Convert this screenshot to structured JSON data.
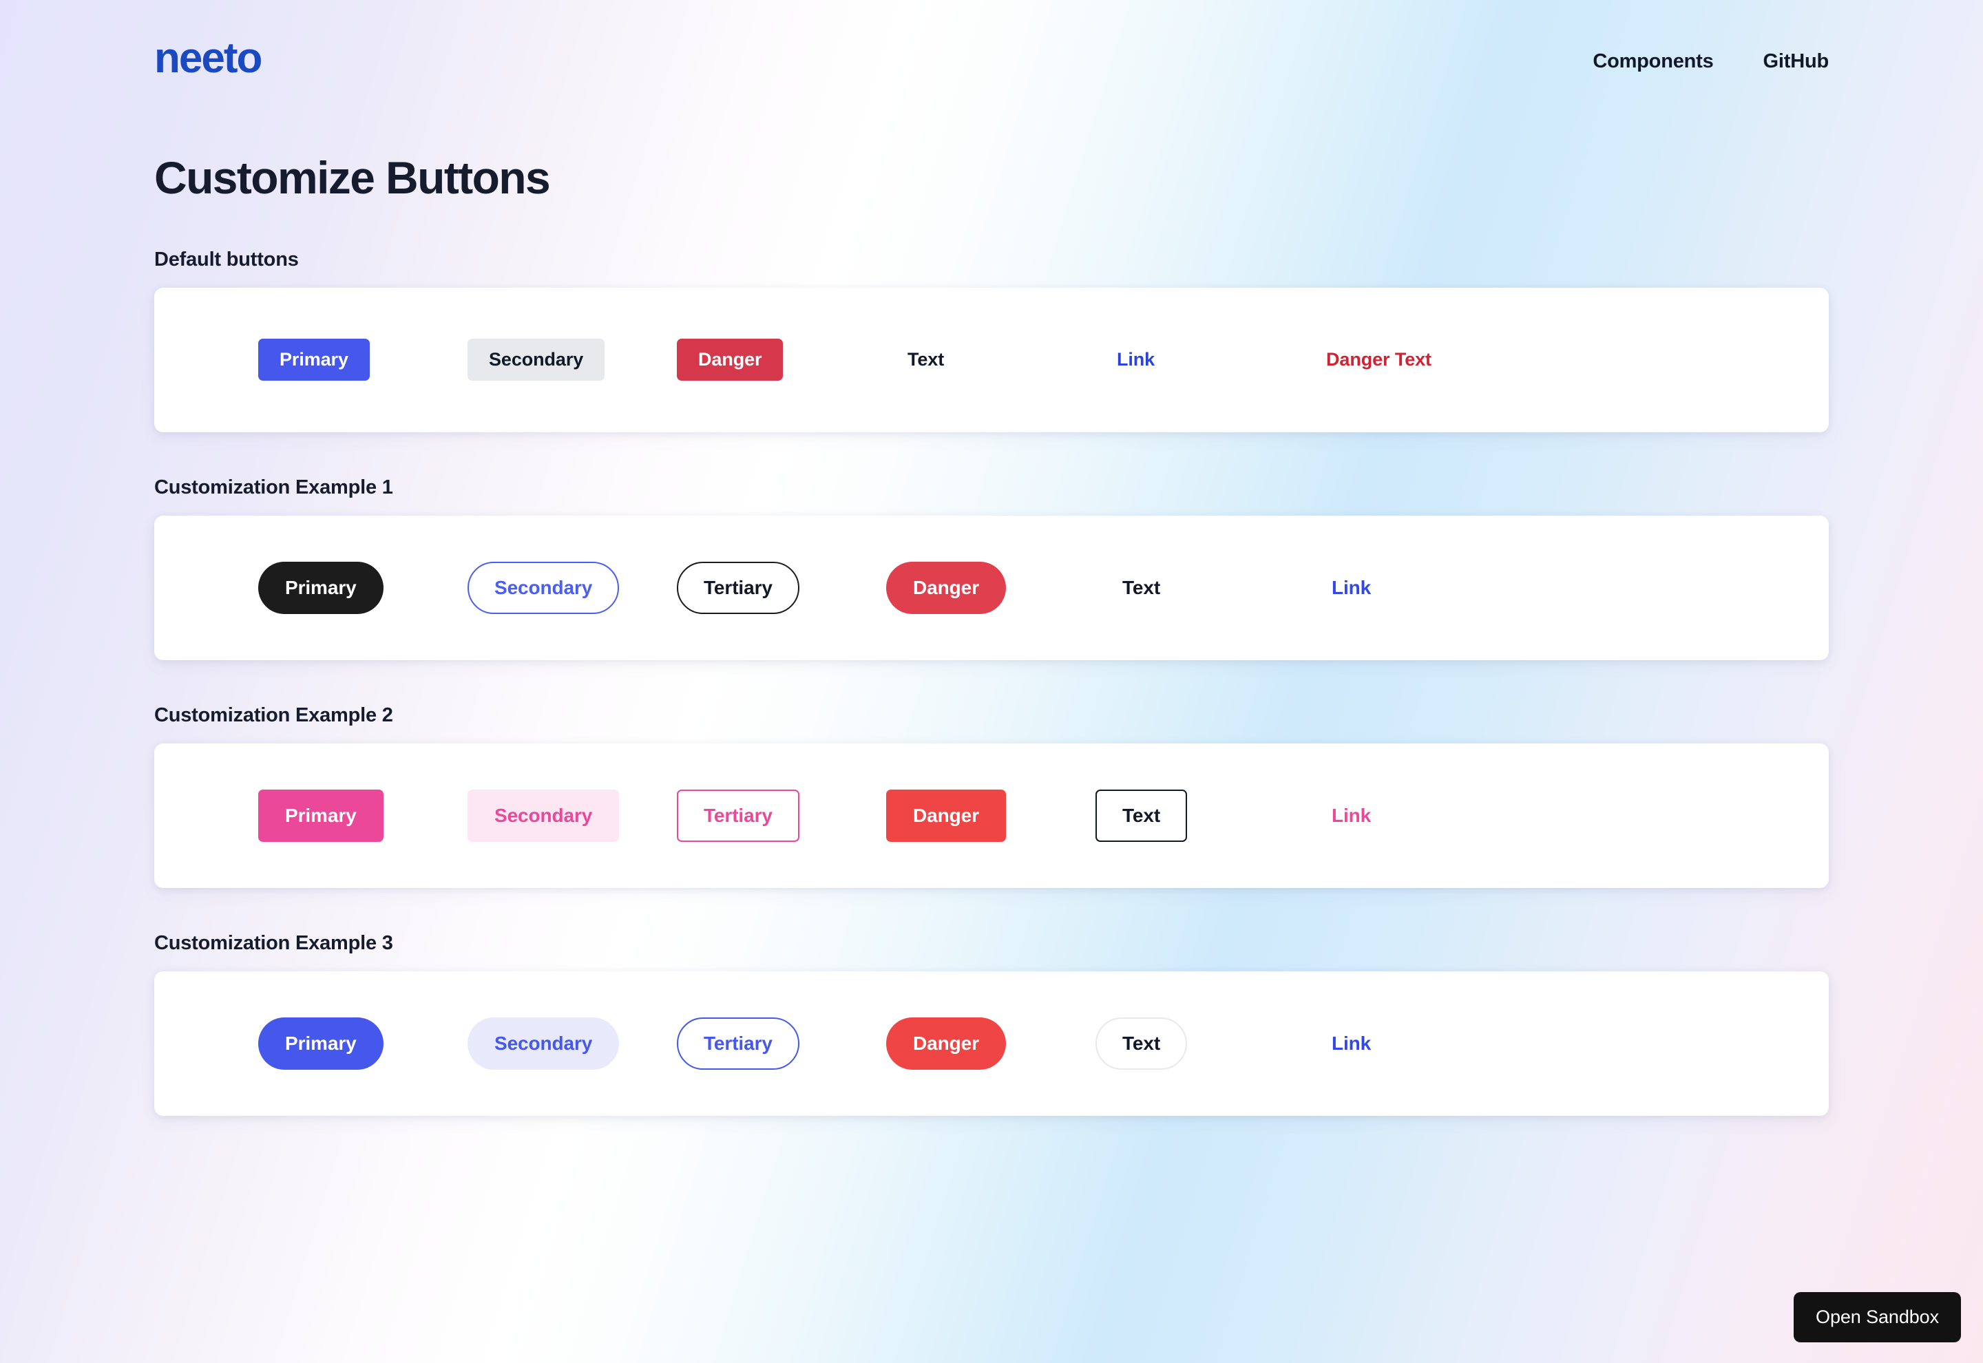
{
  "header": {
    "brand": "neeto",
    "nav": [
      {
        "label": "Components"
      },
      {
        "label": "GitHub"
      }
    ]
  },
  "main": {
    "title": "Customize Buttons",
    "sections": [
      {
        "label": "Default buttons",
        "buttons": [
          {
            "label": "Primary",
            "variant": "primary"
          },
          {
            "label": "Secondary",
            "variant": "secondary"
          },
          {
            "label": "Danger",
            "variant": "danger"
          },
          {
            "label": "Text",
            "variant": "text"
          },
          {
            "label": "Link",
            "variant": "link"
          },
          {
            "label": "Danger Text",
            "variant": "dangertext"
          }
        ]
      },
      {
        "label": "Customization Example 1",
        "buttons": [
          {
            "label": "Primary",
            "variant": "primary"
          },
          {
            "label": "Secondary",
            "variant": "secondary"
          },
          {
            "label": "Tertiary",
            "variant": "tertiary"
          },
          {
            "label": "Danger",
            "variant": "danger"
          },
          {
            "label": "Text",
            "variant": "text"
          },
          {
            "label": "Link",
            "variant": "link"
          }
        ]
      },
      {
        "label": "Customization Example 2",
        "buttons": [
          {
            "label": "Primary",
            "variant": "primary"
          },
          {
            "label": "Secondary",
            "variant": "secondary"
          },
          {
            "label": "Tertiary",
            "variant": "tertiary"
          },
          {
            "label": "Danger",
            "variant": "danger"
          },
          {
            "label": "Text",
            "variant": "text"
          },
          {
            "label": "Link",
            "variant": "link"
          }
        ]
      },
      {
        "label": "Customization Example 3",
        "buttons": [
          {
            "label": "Primary",
            "variant": "primary"
          },
          {
            "label": "Secondary",
            "variant": "secondary"
          },
          {
            "label": "Tertiary",
            "variant": "tertiary"
          },
          {
            "label": "Danger",
            "variant": "danger"
          },
          {
            "label": "Text",
            "variant": "text"
          },
          {
            "label": "Link",
            "variant": "link"
          }
        ]
      }
    ]
  },
  "sandbox": {
    "label": "Open Sandbox"
  },
  "colors": {
    "brand_blue": "#1b4ac0",
    "primary_blue": "#4657eb",
    "link_blue": "#3347e8",
    "danger_red": "#d4384a",
    "danger_red_bright": "#f04545",
    "pink": "#ec4899",
    "pink_soft": "#fce7f3",
    "black": "#1c1c1c",
    "text_dark": "#161b2e",
    "gray_secondary": "#e7e9ec"
  }
}
